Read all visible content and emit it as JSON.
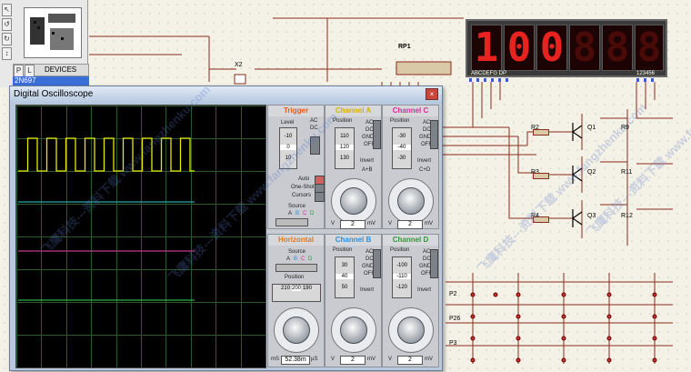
{
  "left_panel": {
    "mode_buttons": [
      "P",
      "L"
    ],
    "devices_label": "DEVICES",
    "selected_device": "2N697"
  },
  "schematic": {
    "component_labels": [
      "RP1",
      "X2",
      "R2",
      "R3",
      "R4",
      "Q1",
      "Q2",
      "Q3",
      "R9",
      "R11",
      "R12"
    ],
    "display_pins_left": "ABCDEFG DP",
    "display_pins_right": "123456",
    "display_digits": [
      "1",
      "0",
      "0",
      "8",
      "8",
      "8"
    ],
    "keypad_labels": [
      "P2",
      "P26",
      "P3"
    ]
  },
  "oscilloscope": {
    "title": "Digital Oscilloscope",
    "close_glyph": "×",
    "trace_colors": {
      "a": "#e8e800",
      "b": "#2aa8a8",
      "c": "#c03a8a",
      "d": "#2fb04a"
    },
    "trigger": {
      "header": "Trigger",
      "level_label": "Level",
      "ac_label": "AC",
      "dc_label": "DC",
      "level_values": [
        "-10",
        "0",
        "10"
      ],
      "modes": [
        "Auto",
        "One-Shot",
        "Cursors"
      ],
      "source_label": "Source",
      "source_channels": [
        "A",
        "B",
        "C",
        "D"
      ]
    },
    "channel_a": {
      "header": "Channel A",
      "position_label": "Position",
      "position_values": [
        "110",
        "120",
        "130"
      ],
      "coupling": [
        "AC",
        "DC",
        "GND",
        "OFF"
      ],
      "invert_label": "Invert",
      "extra_label": "A+B",
      "volt_div": "2",
      "unit_v": "V",
      "unit_mv": "mV"
    },
    "channel_c": {
      "header": "Channel C",
      "position_label": "Position",
      "position_values": [
        "-30",
        "-40",
        "-30"
      ],
      "coupling": [
        "AC",
        "DC",
        "GND",
        "OFF"
      ],
      "invert_label": "Invert",
      "extra_label": "C+D",
      "volt_div": "2",
      "unit_v": "V",
      "unit_mv": "mV"
    },
    "horizontal": {
      "header": "Horizontal",
      "source_label": "Source",
      "source_channels": [
        "A",
        "B",
        "C",
        "D"
      ],
      "position_label": "Position",
      "position_values": [
        "210",
        "200",
        "190"
      ],
      "time_readout": "52.38m",
      "unit_ms": "mS",
      "unit_us": "µS"
    },
    "channel_b": {
      "header": "Channel B",
      "position_label": "Position",
      "position_values": [
        "30",
        "40",
        "50"
      ],
      "coupling": [
        "AC",
        "DC",
        "GND",
        "OFF"
      ],
      "invert_label": "Invert",
      "volt_div": "2",
      "unit_v": "V",
      "unit_mv": "mV"
    },
    "channel_d": {
      "header": "Channel D",
      "position_label": "Position",
      "position_values": [
        "-100",
        "-110",
        "-120"
      ],
      "coupling": [
        "AC",
        "DC",
        "GND",
        "OFF"
      ],
      "invert_label": "Invert",
      "volt_div": "2",
      "unit_v": "V",
      "unit_mv": "mV"
    }
  },
  "watermark": "飞鹰科技---资料下载 www.fangzhenku.com",
  "colors": {
    "trigger": "#e45a1a",
    "channel_a": "#d4b400",
    "channel_b": "#2f8fd8",
    "channel_c": "#d0309a",
    "channel_d": "#2f9a3a",
    "horizontal": "#e4781a"
  }
}
